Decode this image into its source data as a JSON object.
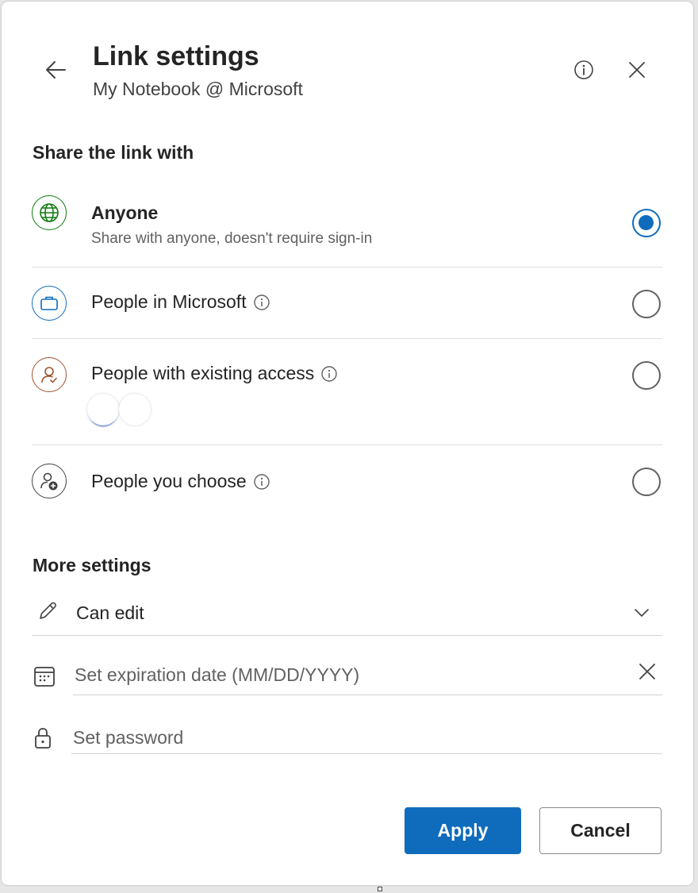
{
  "header": {
    "title": "Link settings",
    "subtitle": "My Notebook @ Microsoft",
    "back_icon": "arrow-left-icon",
    "info_icon": "info-icon",
    "close_icon": "close-icon"
  },
  "share_section": {
    "heading": "Share the link with",
    "selected": "anyone",
    "options": [
      {
        "id": "anyone",
        "label": "Anyone",
        "description": "Share with anyone, doesn't require sign-in",
        "icon": "globe-icon",
        "icon_color": "#107c10",
        "selected": true,
        "has_info": false
      },
      {
        "id": "org",
        "label": "People in Microsoft",
        "icon": "briefcase-icon",
        "icon_color": "#0f6cbd",
        "selected": false,
        "has_info": true
      },
      {
        "id": "existing",
        "label": "People with existing access",
        "icon": "person-check-icon",
        "icon_color": "#a0522d",
        "selected": false,
        "has_info": true
      },
      {
        "id": "choose",
        "label": "People you choose",
        "icon": "person-add-icon",
        "icon_color": "#424242",
        "selected": false,
        "has_info": true
      }
    ]
  },
  "more_settings": {
    "heading": "More settings",
    "permission": {
      "value": "Can edit",
      "icon": "pencil-icon",
      "dropdown_icon": "chevron-down-icon"
    },
    "expiration": {
      "placeholder": "Set expiration date (MM/DD/YYYY)",
      "icon": "calendar-icon",
      "clear_icon": "close-icon"
    },
    "password": {
      "placeholder": "Set password",
      "icon": "lock-icon"
    }
  },
  "footer": {
    "apply_label": "Apply",
    "cancel_label": "Cancel"
  },
  "colors": {
    "accent": "#0f6cbd",
    "text_primary": "#242424",
    "text_secondary": "#616161",
    "divider": "#e0e0e0"
  }
}
